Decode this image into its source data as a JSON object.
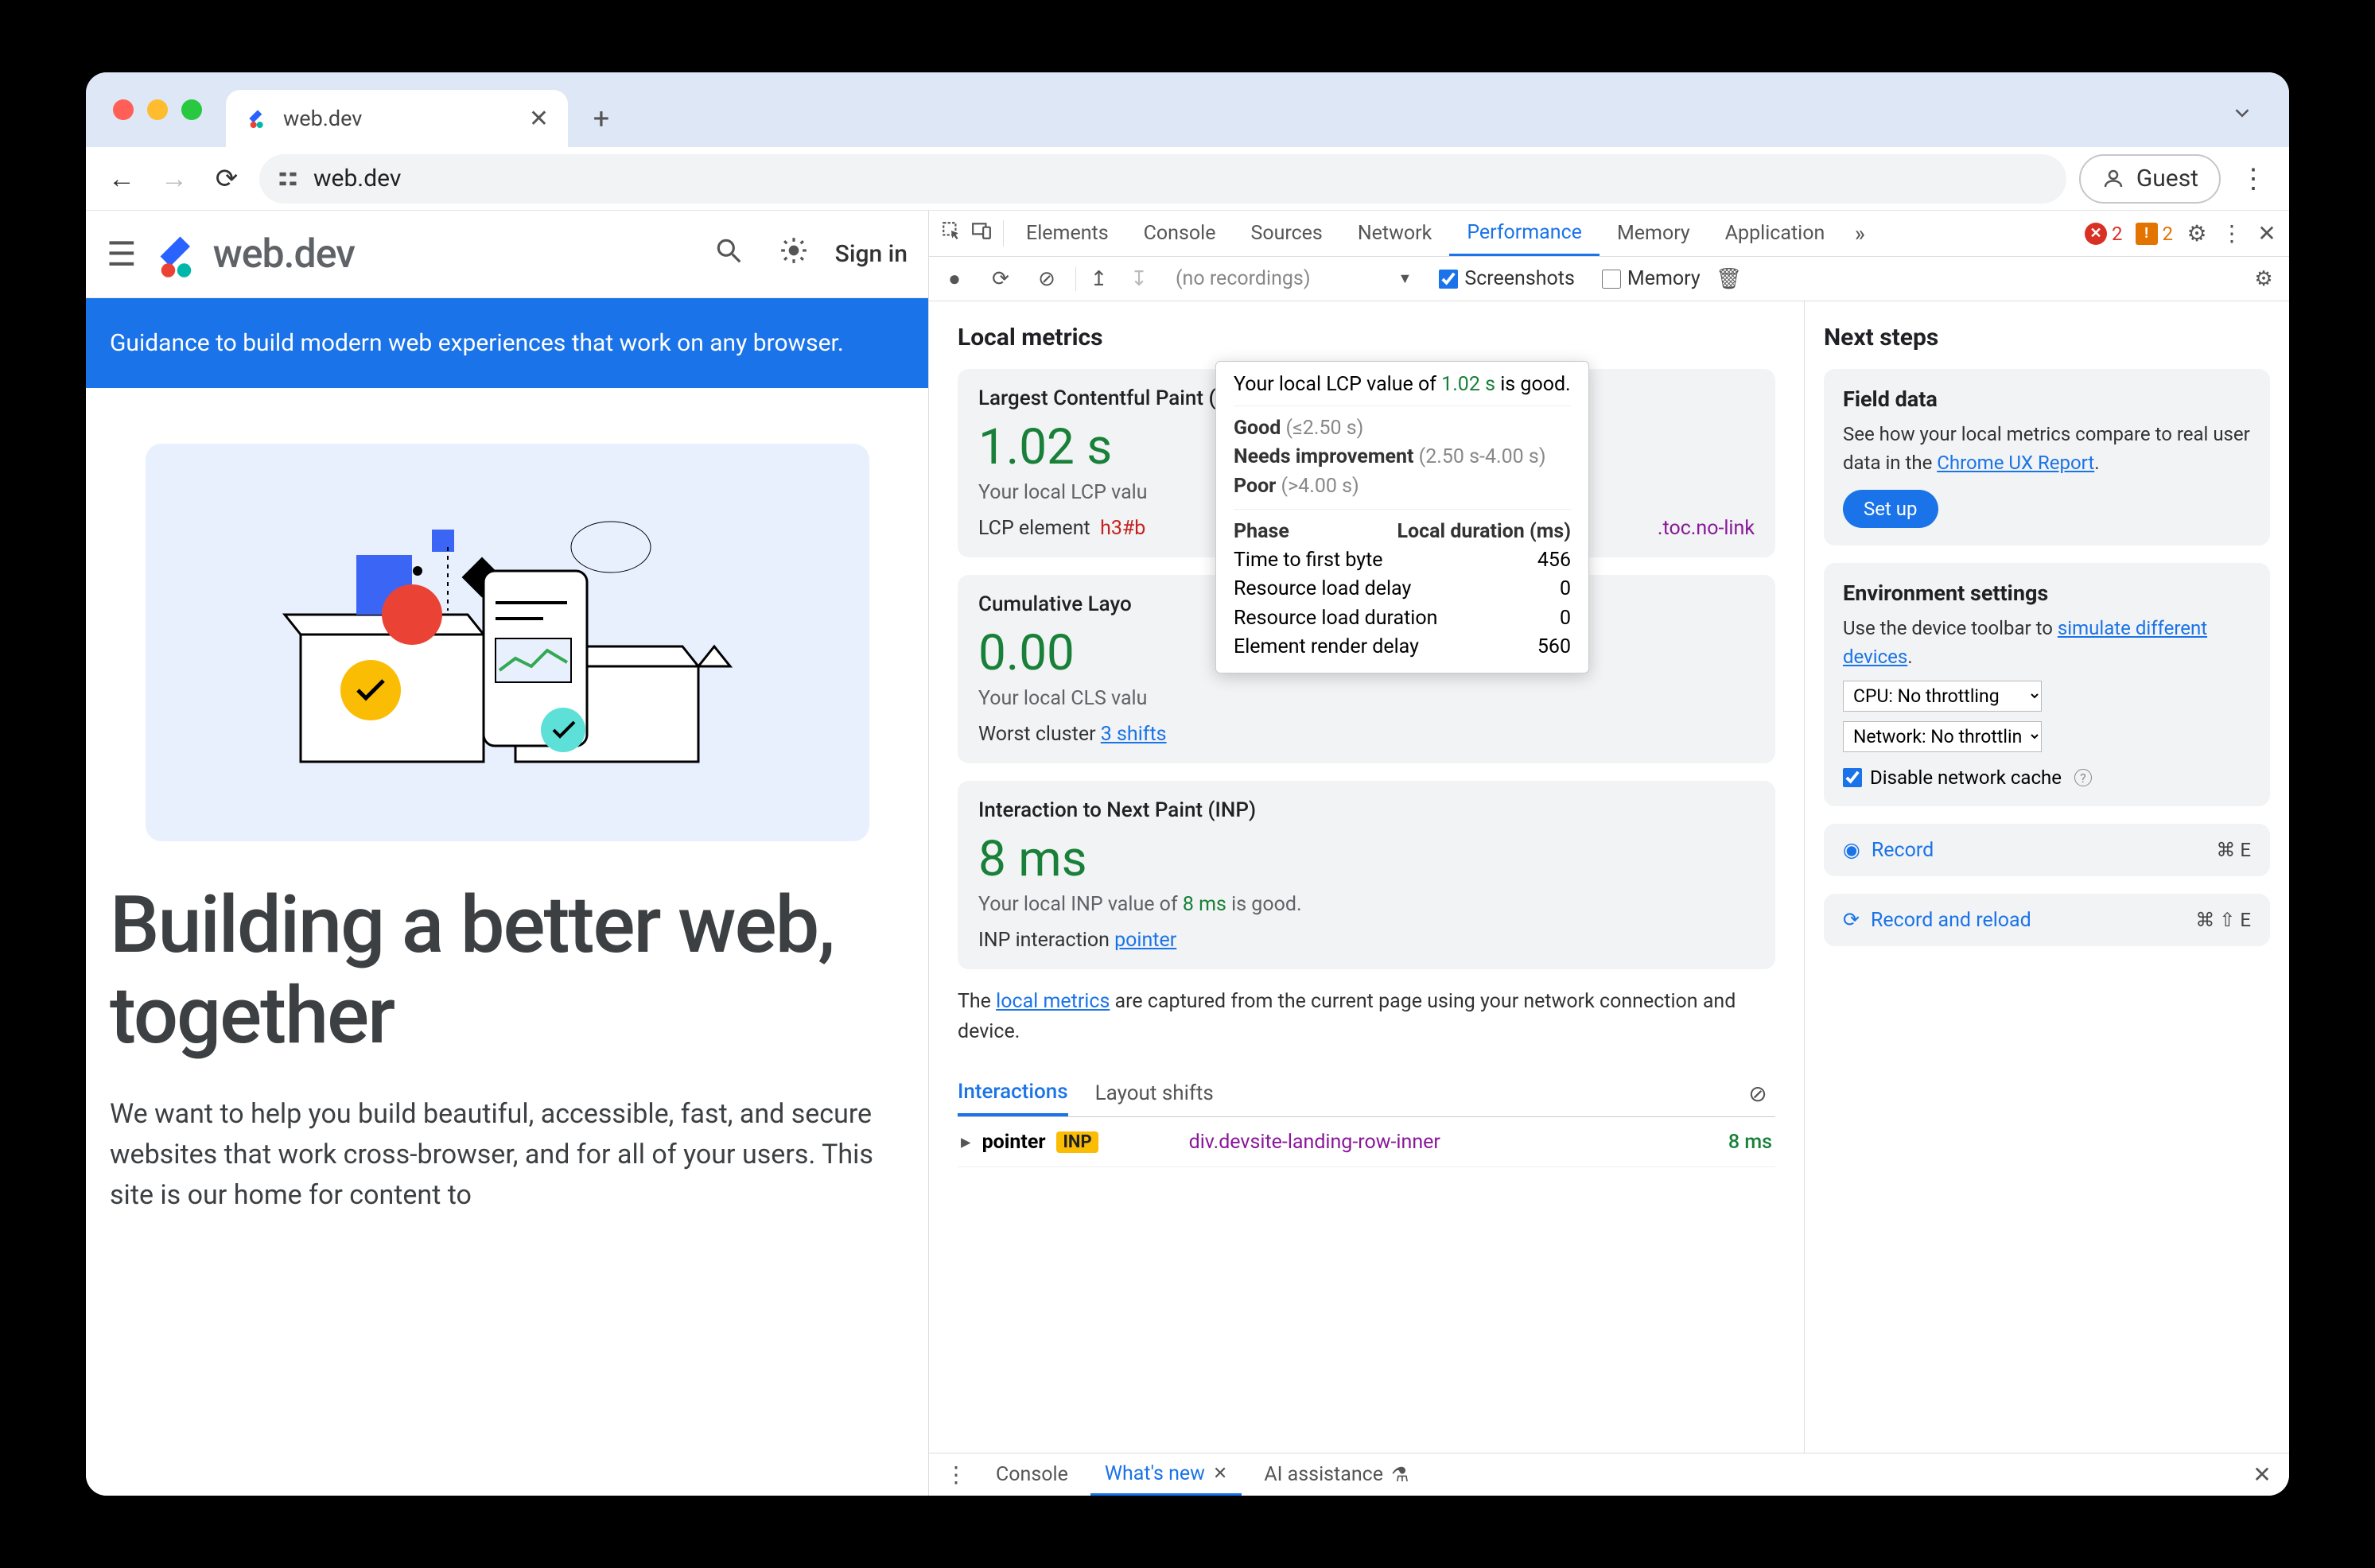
{
  "browser": {
    "tab_title": "web.dev",
    "url": "web.dev",
    "guest": "Guest"
  },
  "page": {
    "logo_text": "web.dev",
    "signin": "Sign in",
    "banner": "Guidance to build modern web experiences that work on any browser.",
    "hero_title": "Building a better web, together",
    "hero_body": "We want to help you build beautiful, accessible, fast, and secure websites that work cross-browser, and for all of your users. This site is our home for content to"
  },
  "devtools": {
    "tabs": [
      "Elements",
      "Console",
      "Sources",
      "Network",
      "Performance",
      "Memory",
      "Application"
    ],
    "active_tab": "Performance",
    "errors": "2",
    "warnings": "2",
    "recordings": "(no recordings)",
    "screenshots_label": "Screenshots",
    "memory_label": "Memory",
    "local_metrics_title": "Local metrics",
    "next_steps_title": "Next steps",
    "lcp": {
      "label": "Largest Contentful Paint (LCP)",
      "value": "1.02 s",
      "note": "Your local LCP valu",
      "element_label": "LCP element",
      "element": "h3#b",
      "toc": ".toc.no-link"
    },
    "tooltip": {
      "top_pre": "Your local LCP value of ",
      "top_val": "1.02 s",
      "top_post": " is good.",
      "good_l": "Good",
      "good_v": "(≤2.50 s)",
      "ni_l": "Needs improvement",
      "ni_v": "(2.50 s-4.00 s)",
      "poor_l": "Poor",
      "poor_v": "(>4.00 s)",
      "phase": "Phase",
      "duration": "Local duration (ms)",
      "rows": [
        {
          "k": "Time to first byte",
          "v": "456"
        },
        {
          "k": "Resource load delay",
          "v": "0"
        },
        {
          "k": "Resource load duration",
          "v": "0"
        },
        {
          "k": "Element render delay",
          "v": "560"
        }
      ]
    },
    "cls": {
      "label": "Cumulative Layo",
      "value": "0.00",
      "note": "Your local CLS valu",
      "worst_label": "Worst cluster",
      "worst_link": "3 shifts"
    },
    "inp": {
      "label": "Interaction to Next Paint (INP)",
      "value": "8 ms",
      "note_pre": "Your local INP value of ",
      "note_val": "8 ms",
      "note_post": " is good.",
      "interaction_label": "INP interaction",
      "interaction_link": "pointer"
    },
    "help_pre": "The ",
    "help_link": "local metrics",
    "help_post": " are captured from the current page using your network connection and device.",
    "sub_tabs": {
      "interactions": "Interactions",
      "layout": "Layout shifts"
    },
    "interaction_row": {
      "type": "pointer",
      "badge": "INP",
      "target": "div.devsite-landing-row-inner",
      "time": "8 ms"
    },
    "field_data": {
      "h": "Field data",
      "body_pre": "See how your local metrics compare to real user data in the ",
      "body_link": "Chrome UX Report",
      "setup": "Set up"
    },
    "env": {
      "h": "Environment settings",
      "body_pre": "Use the device toolbar to ",
      "body_link": "simulate different devices",
      "cpu": "CPU: No throttling",
      "net": "Network: No throttling",
      "disable_cache": "Disable network cache"
    },
    "record": "Record",
    "record_kbd": "⌘ E",
    "record_reload": "Record and reload",
    "record_reload_kbd": "⌘ ⇧ E",
    "footer": {
      "console": "Console",
      "whatsnew": "What's new",
      "ai": "AI assistance"
    }
  }
}
